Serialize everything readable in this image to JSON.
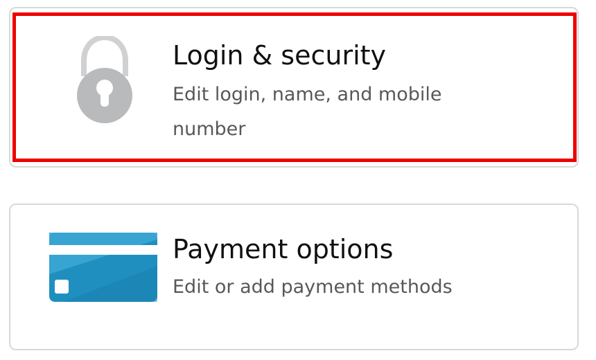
{
  "cards": [
    {
      "title": "Login & security",
      "description": "Edit login, name, and mobile number",
      "icon": "lock-icon",
      "highlighted": true,
      "highlight_color": "#ee0000"
    },
    {
      "title": "Payment options",
      "description": "Edit or add payment methods",
      "icon": "credit-card-icon",
      "highlighted": false
    }
  ],
  "colors": {
    "title_text": "#0f1111",
    "description_text": "#565959",
    "card_border": "#d5d9d9",
    "lock_icon": "#b8babb",
    "card_icon_primary": "#1f8fc0",
    "card_icon_secondary": "#3aa6d4"
  }
}
